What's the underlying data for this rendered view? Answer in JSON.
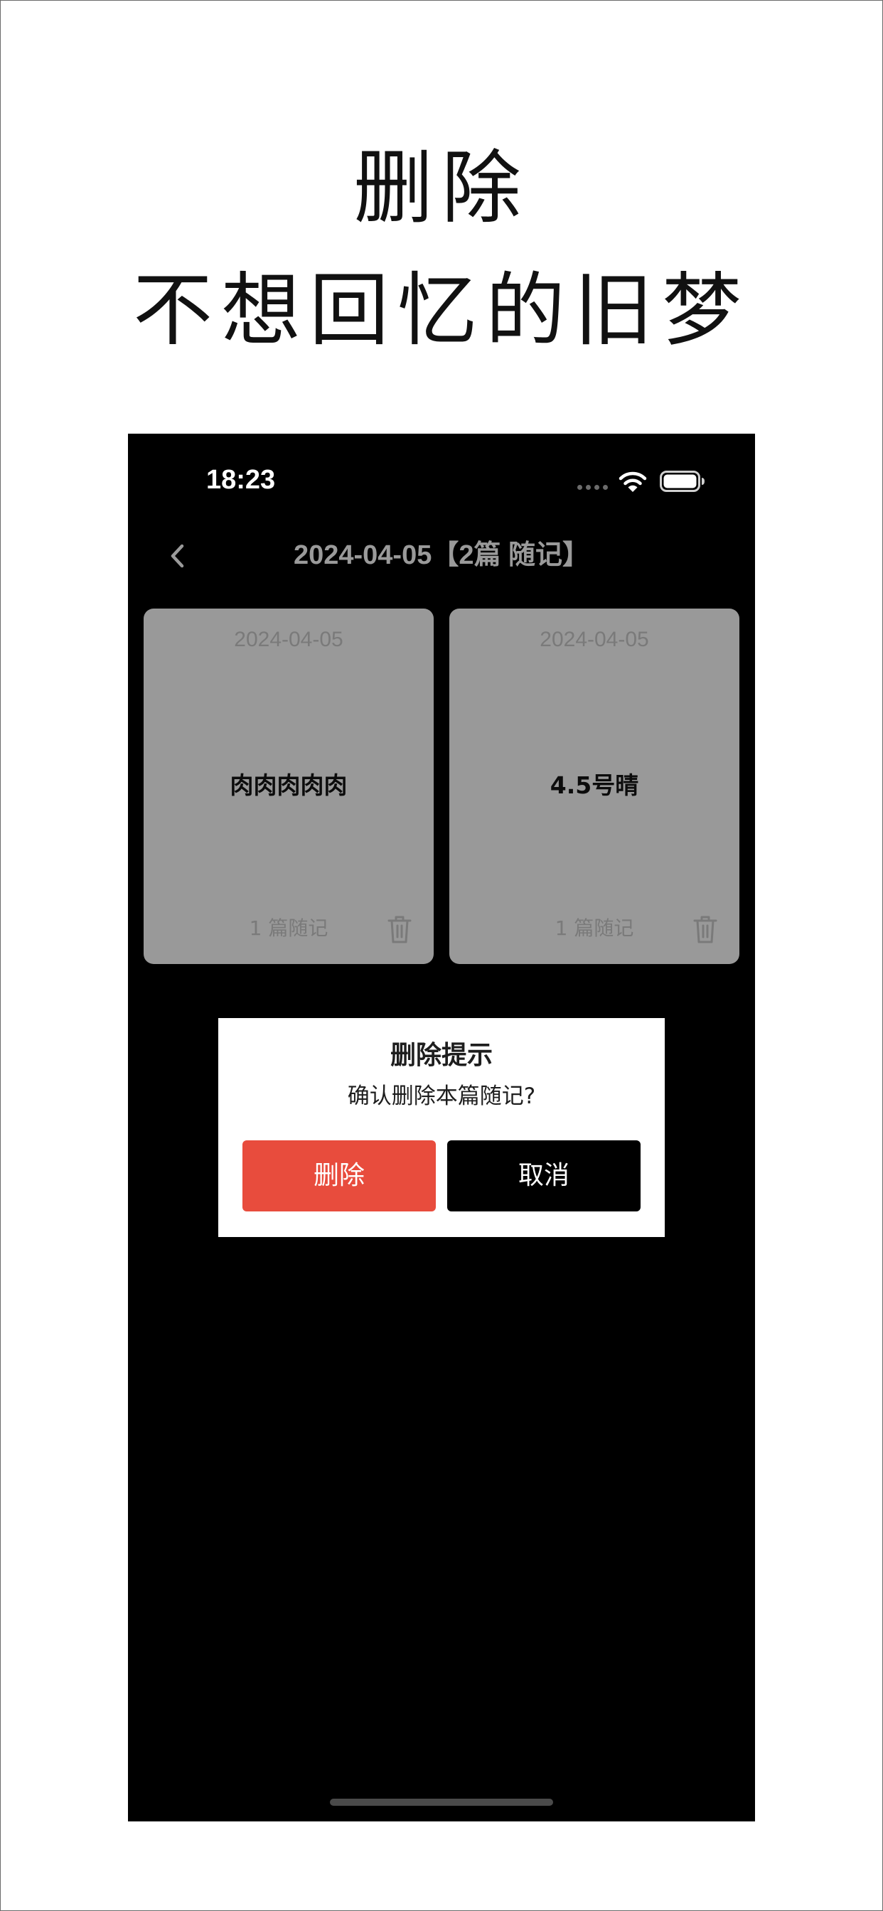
{
  "promo": {
    "line1": "删除",
    "line2": "不想回忆的旧梦"
  },
  "status_bar": {
    "time": "18:23",
    "icons": [
      "signal-dots-icon",
      "wifi-icon",
      "battery-icon"
    ]
  },
  "nav": {
    "back_icon": "chevron-left-icon",
    "title": "2024-04-05【2篇 随记】"
  },
  "cards": [
    {
      "date": "2024-04-05",
      "title": "肉肉肉肉肉",
      "count": "1 篇随记",
      "delete_icon": "trash-icon"
    },
    {
      "date": "2024-04-05",
      "title": "4.5号晴",
      "count": "1 篇随记",
      "delete_icon": "trash-icon"
    }
  ],
  "dialog": {
    "title": "删除提示",
    "message": "确认删除本篇随记?",
    "confirm_label": "删除",
    "cancel_label": "取消"
  },
  "colors": {
    "screen_bg": "#000000",
    "card_bg": "#999999",
    "delete_button": "#e84c3d",
    "cancel_button": "#000000",
    "dialog_bg": "#ffffff"
  }
}
